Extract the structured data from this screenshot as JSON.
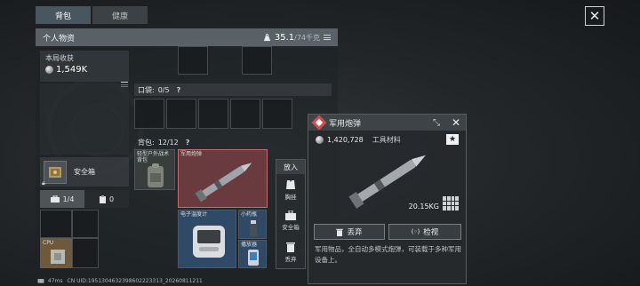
{
  "tabs": {
    "backpack": "背包",
    "health": "健康"
  },
  "header": {
    "title": "个人物资",
    "weight_current": "35.1",
    "weight_max": "/74千克"
  },
  "income": {
    "label": "本局收获",
    "value": "1,549K"
  },
  "pocket": {
    "label": "口袋:",
    "count": "0/5",
    "help": "?"
  },
  "backpack": {
    "label": "背包:",
    "count": "12/12",
    "help": "?"
  },
  "safe_box": {
    "label": "安全箱"
  },
  "stats": {
    "first": "1/4",
    "second": "0"
  },
  "items": {
    "bag": "轻型户外战术背包",
    "shell": "军用炮弹",
    "thermometer": "电子温度计",
    "medicine": "小药瓶",
    "phone": "播放器",
    "cpu": "CPU"
  },
  "side_buttons": {
    "put": "放入",
    "tactical": "胸挂",
    "safe": "安全箱",
    "discard": "丢弃"
  },
  "detail": {
    "title": "军用炮弹",
    "price": "1,420,728",
    "category": "工具材料",
    "weight": "20.15KG",
    "discard_label": "丢弃",
    "inspect_label": "检视",
    "description": "军用物品，全自动多模式炮弹，可装载于多种军用设备上。"
  },
  "status": {
    "ping": "47ms",
    "uid": "CN UID:1951304632398602223313_20260811211"
  },
  "colors": {
    "accent_red": "#d94b4b",
    "selected_bg": "#6a3b3e"
  }
}
